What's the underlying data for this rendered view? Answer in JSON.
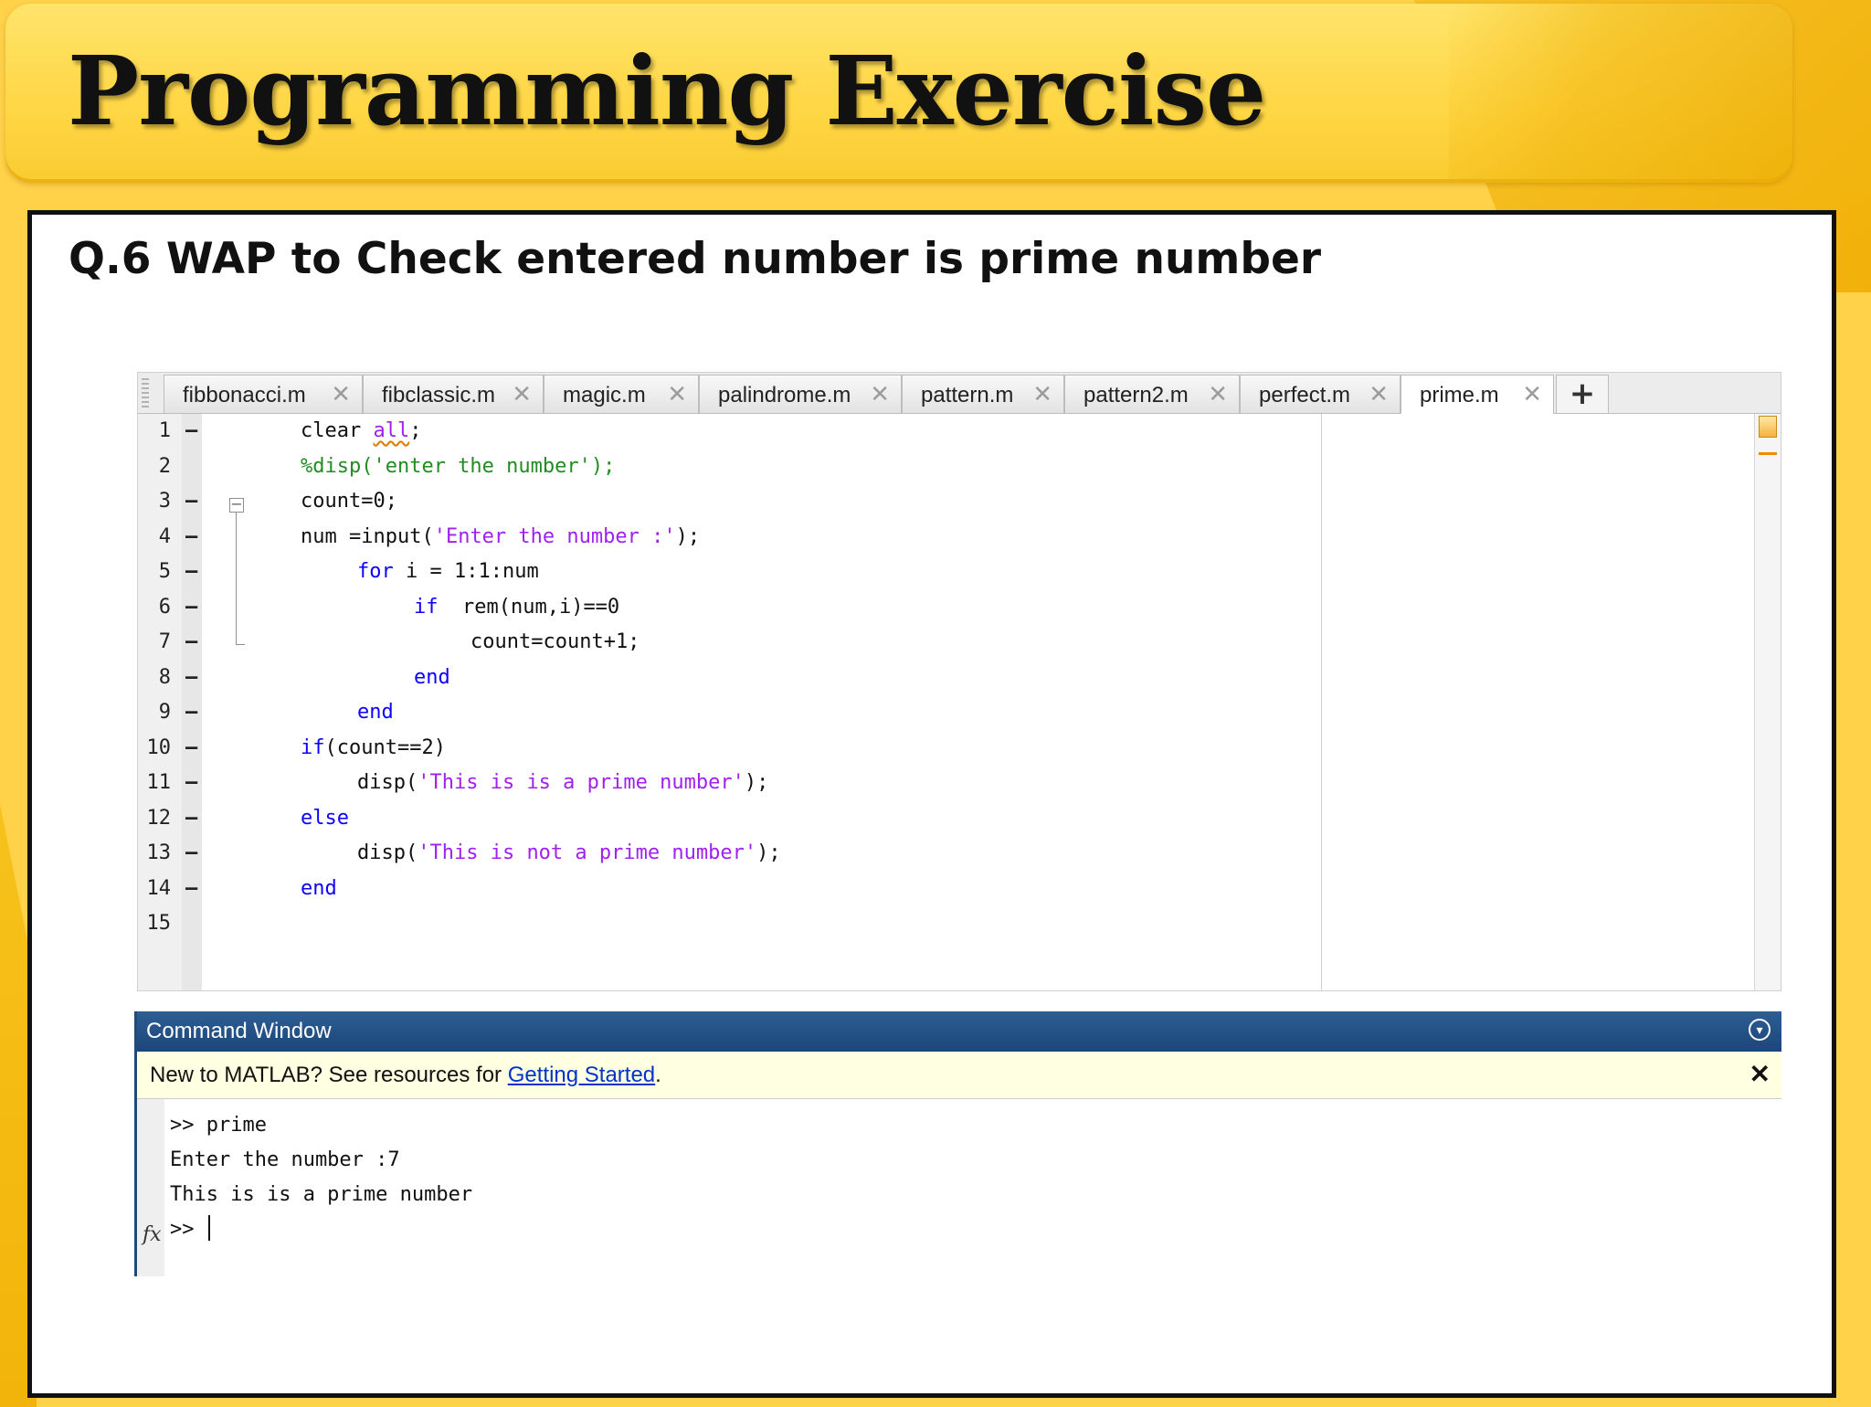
{
  "slide": {
    "title": "Programming Exercise",
    "question": "Q.6  WAP to Check entered number is prime number"
  },
  "editor": {
    "tabs": [
      {
        "label": "fibbonacci.m",
        "active": false
      },
      {
        "label": "fibclassic.m",
        "active": false
      },
      {
        "label": "magic.m",
        "active": false
      },
      {
        "label": "palindrome.m",
        "active": false
      },
      {
        "label": "pattern.m",
        "active": false
      },
      {
        "label": "pattern2.m",
        "active": false
      },
      {
        "label": "perfect.m",
        "active": false
      },
      {
        "label": "prime.m",
        "active": true
      }
    ],
    "add_tab_label": "+",
    "close_glyph": "✕",
    "lines": [
      {
        "num": "1",
        "mark": "–",
        "segments": [
          {
            "t": "clear ",
            "c": "plain"
          },
          {
            "t": "all",
            "c": "sq"
          },
          {
            "t": ";",
            "c": "plain"
          }
        ],
        "indent": 0
      },
      {
        "num": "2",
        "mark": "",
        "segments": [
          {
            "t": "%disp('enter the number');",
            "c": "cmt"
          }
        ],
        "indent": 0
      },
      {
        "num": "3",
        "mark": "–",
        "segments": [
          {
            "t": "count=0;",
            "c": "plain"
          }
        ],
        "indent": 0
      },
      {
        "num": "4",
        "mark": "–",
        "segments": [
          {
            "t": "num =input(",
            "c": "plain"
          },
          {
            "t": "'Enter the number :'",
            "c": "str"
          },
          {
            "t": ");",
            "c": "plain"
          }
        ],
        "indent": 0
      },
      {
        "num": "5",
        "mark": "–",
        "segments": [
          {
            "t": "for",
            "c": "kw"
          },
          {
            "t": " i = 1:1:num",
            "c": "plain"
          }
        ],
        "indent": 1
      },
      {
        "num": "6",
        "mark": "–",
        "segments": [
          {
            "t": "if",
            "c": "kw"
          },
          {
            "t": "  rem(num,i)==0",
            "c": "plain"
          }
        ],
        "indent": 2
      },
      {
        "num": "7",
        "mark": "–",
        "segments": [
          {
            "t": "count=count+1;",
            "c": "plain"
          }
        ],
        "indent": 3
      },
      {
        "num": "8",
        "mark": "–",
        "segments": [
          {
            "t": "end",
            "c": "kw"
          }
        ],
        "indent": 2
      },
      {
        "num": "9",
        "mark": "–",
        "segments": [
          {
            "t": "end",
            "c": "kw"
          }
        ],
        "indent": 1
      },
      {
        "num": "10",
        "mark": "–",
        "segments": [
          {
            "t": "if",
            "c": "kw"
          },
          {
            "t": "(count==2)",
            "c": "plain"
          }
        ],
        "indent": 0
      },
      {
        "num": "11",
        "mark": "–",
        "segments": [
          {
            "t": "disp(",
            "c": "plain"
          },
          {
            "t": "'This is is a prime number'",
            "c": "str"
          },
          {
            "t": ");",
            "c": "plain"
          }
        ],
        "indent": 1
      },
      {
        "num": "12",
        "mark": "–",
        "segments": [
          {
            "t": "else",
            "c": "kw"
          }
        ],
        "indent": 0
      },
      {
        "num": "13",
        "mark": "–",
        "segments": [
          {
            "t": "disp(",
            "c": "plain"
          },
          {
            "t": "'This is not a prime number'",
            "c": "str"
          },
          {
            "t": ");",
            "c": "plain"
          }
        ],
        "indent": 1
      },
      {
        "num": "14",
        "mark": "–",
        "segments": [
          {
            "t": "end",
            "c": "kw"
          }
        ],
        "indent": 0
      },
      {
        "num": "15",
        "mark": "",
        "segments": [],
        "indent": 0
      }
    ]
  },
  "command_window": {
    "title": "Command Window",
    "menu_glyph": "▾",
    "banner_prefix": "New to MATLAB? See resources for ",
    "banner_link": "Getting Started",
    "banner_suffix": ".",
    "banner_close": "✕",
    "fx_label": "fx",
    "output": [
      ">> prime",
      "Enter the number :7",
      "This is is a prime number"
    ],
    "prompt": ">> "
  },
  "colors": {
    "keyword": "#0E00FF",
    "string": "#A020F0",
    "comment": "#228B22",
    "cmd_header": "#1C4678",
    "banner_bg": "#FFFFE1",
    "slide_yellow": "#FFD24A"
  }
}
